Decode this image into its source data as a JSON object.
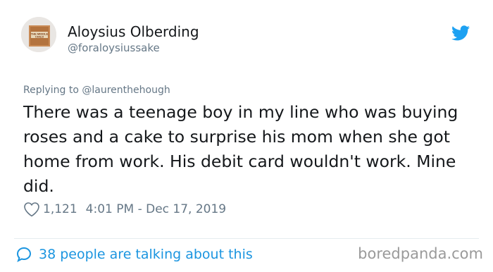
{
  "user": {
    "display_name": "Aloysius Olberding",
    "handle": "@foraloysiussake",
    "avatar_text_1": "THE MIDDLE",
    "avatar_text_2": "CHILD"
  },
  "tweet": {
    "replying_to_prefix": "Replying to",
    "replying_to_handle": "@laurenthehough",
    "text": "There was a teenage boy in my line who was buying roses and a cake to surprise his mom when she got home from work. His debit card wouldn't work. Mine did.",
    "likes": "1,121",
    "timestamp": "4:01 PM - Dec 17, 2019"
  },
  "footer": {
    "talking_text": "38 people are talking about this",
    "watermark": "boredpanda.com"
  },
  "colors": {
    "twitter_blue": "#1da1f2",
    "link_blue": "#1b95e0",
    "muted": "#657786"
  },
  "icons": [
    "twitter-bird-icon",
    "heart-icon",
    "speech-bubble-icon"
  ]
}
